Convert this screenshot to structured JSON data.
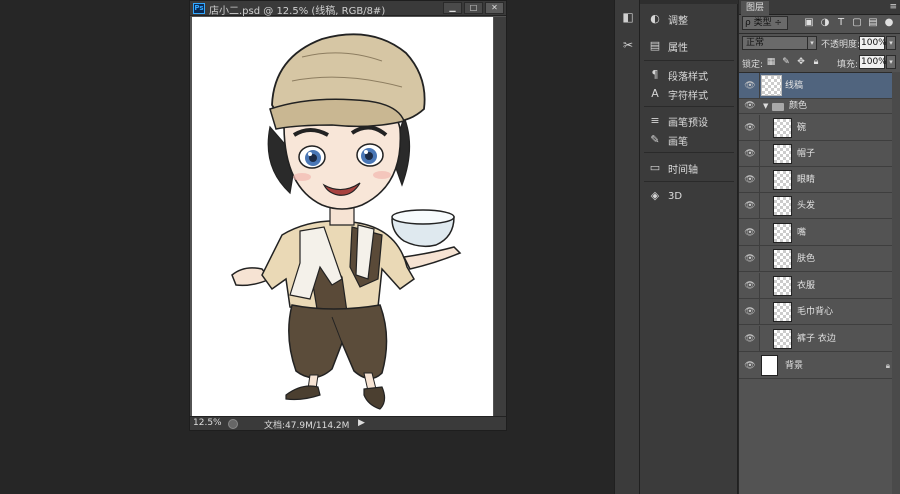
{
  "document": {
    "app_badge": "Ps",
    "title": "店小二.psd @ 12.5% (线稿, RGB/8#)",
    "buttons": {
      "minimize": "▁",
      "maximize": "□",
      "close": "✕"
    },
    "status": {
      "zoom": "12.5%",
      "doc_info": "文档:47.9M/114.2M",
      "arrow": "▶"
    }
  },
  "strip2": {
    "items": [
      {
        "label": "调整",
        "icon": "adjustments-icon"
      },
      {
        "label": "属性",
        "icon": "properties-icon"
      },
      {
        "label": "段落样式",
        "icon": "paragraph-styles-icon"
      },
      {
        "label": "字符样式",
        "icon": "character-styles-icon"
      },
      {
        "label": "画笔预设",
        "icon": "brush-presets-icon"
      },
      {
        "label": "画笔",
        "icon": "brush-icon"
      },
      {
        "label": "时间轴",
        "icon": "timeline-icon"
      },
      {
        "label": "3D",
        "icon": "3d-icon"
      }
    ]
  },
  "layers_panel": {
    "tab": "图层",
    "menu": "≡",
    "filter": {
      "kind": "ρ 类型 ÷"
    },
    "blend_mode": "正常",
    "opacity_label": "不透明度:",
    "opacity": "100%",
    "lock_label": "锁定:",
    "fill_label": "填充:",
    "fill": "100%",
    "top_layer": "线稿",
    "group_name": "颜色",
    "group_layers": [
      "碗",
      "帽子",
      "眼睛",
      "头发",
      "嘴",
      "肤色",
      "衣服",
      "毛巾背心",
      "裤子 衣边"
    ],
    "background": "背景"
  }
}
